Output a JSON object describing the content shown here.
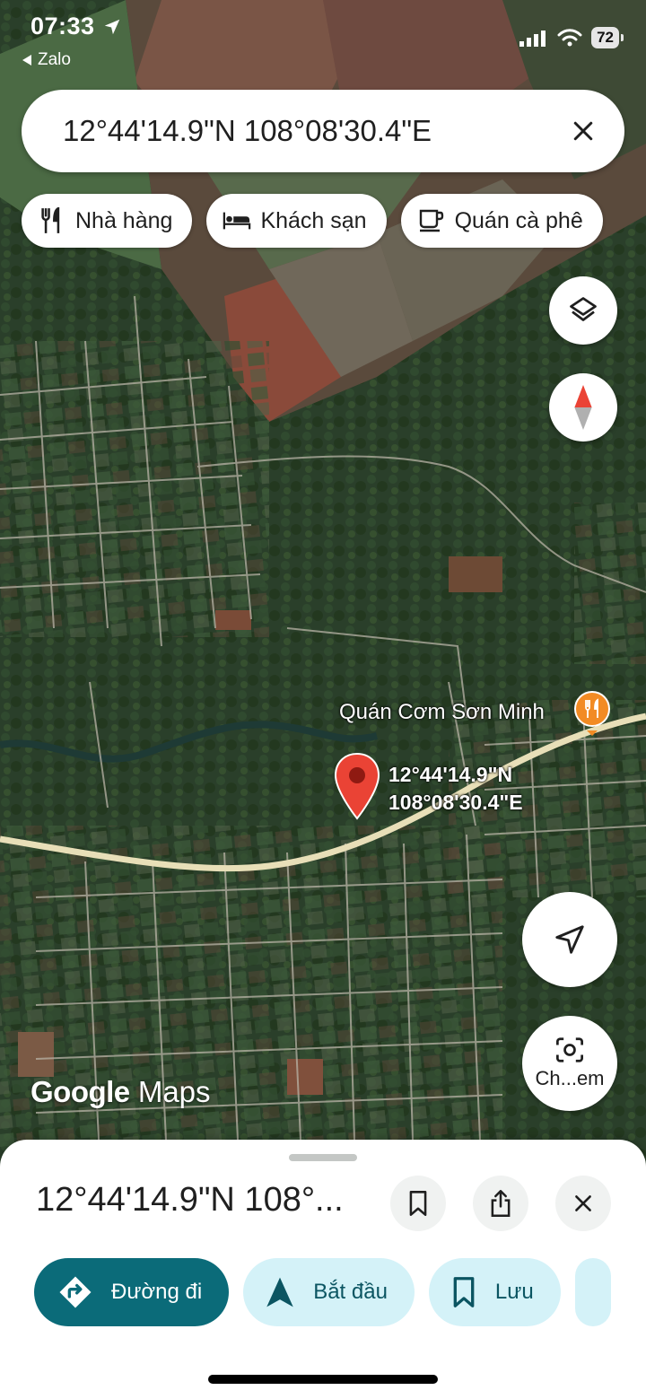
{
  "status_bar": {
    "time": "07:33",
    "back_app": "Zalo",
    "battery": "72"
  },
  "search": {
    "query": "12°44'14.9\"N 108°08'30.4\"E"
  },
  "chips": [
    {
      "label": "Nhà hàng",
      "icon": "restaurant-icon"
    },
    {
      "label": "Khách sạn",
      "icon": "hotel-bed-icon"
    },
    {
      "label": "Quán cà phê",
      "icon": "coffee-cup-icon"
    }
  ],
  "map": {
    "poi_name": "Quán Cơm Sơn Minh",
    "pin_coord_line1": "12°44'14.9\"N",
    "pin_coord_line2": "108°08'30.4\"E",
    "logo": {
      "google": "Google",
      "maps": "Maps"
    },
    "camera_label": "Ch...em"
  },
  "sheet": {
    "title": "12°44'14.9\"N 108°...",
    "actions": [
      {
        "label": "Đường đi",
        "icon": "directions-icon"
      },
      {
        "label": "Bắt đầu",
        "icon": "navigation-arrow-icon"
      },
      {
        "label": "Lưu",
        "icon": "bookmark-icon"
      }
    ]
  },
  "colors": {
    "primary": "#0b6b79",
    "secondary": "#d4f2f8",
    "pin_red": "#ea4335",
    "poi_orange": "#f28b24"
  }
}
